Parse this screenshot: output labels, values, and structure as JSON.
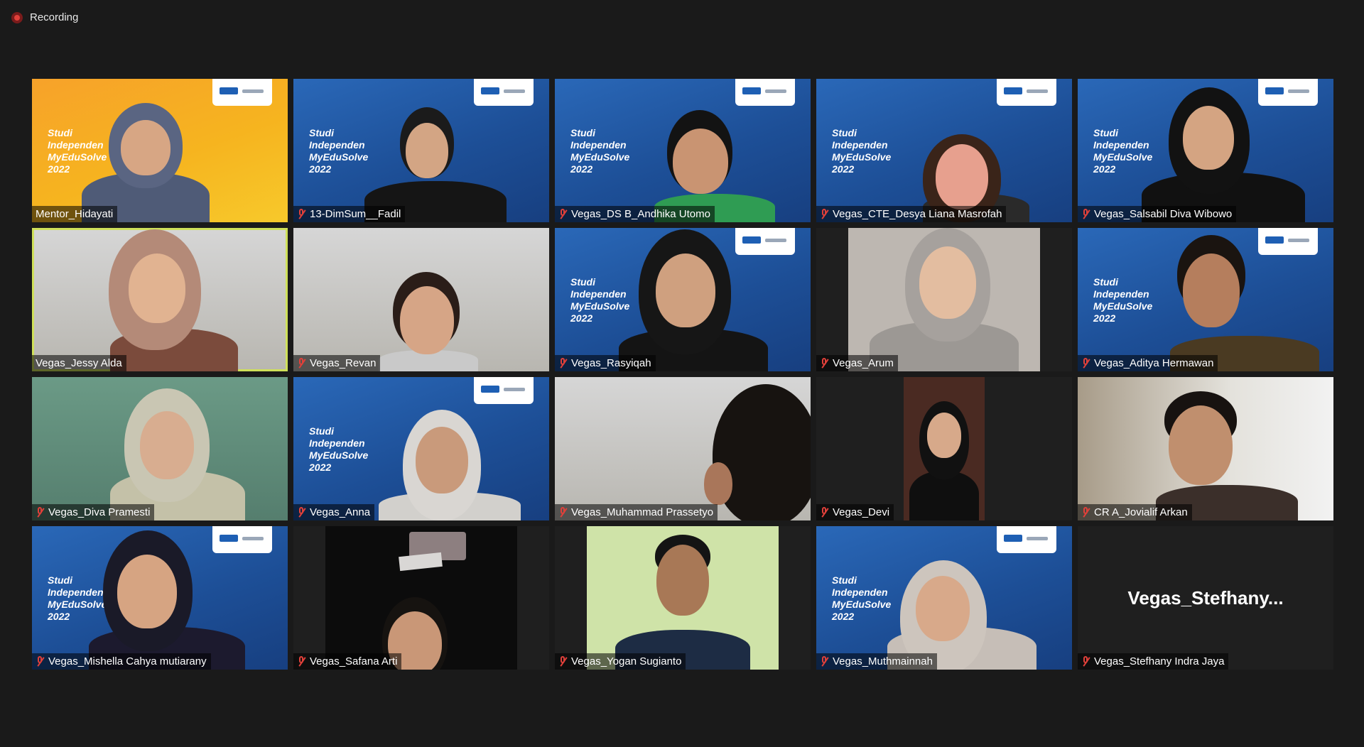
{
  "recording": {
    "label": "Recording"
  },
  "brand_text": "Studi\nIndependen\nMyEduSolve\n2022",
  "tiles": [
    {
      "name": "Mentor_Hidayati",
      "muted": false
    },
    {
      "name": "13-DimSum__Fadil",
      "muted": true
    },
    {
      "name": "Vegas_DS B_Andhika Utomo",
      "muted": true
    },
    {
      "name": "Vegas_CTE_Desya Liana Masrofah",
      "muted": true
    },
    {
      "name": "Vegas_Salsabil Diva Wibowo",
      "muted": true
    },
    {
      "name": "Vegas_Jessy Alda",
      "muted": false,
      "active": true
    },
    {
      "name": "Vegas_Revan",
      "muted": true
    },
    {
      "name": "Vegas_Rasyiqah",
      "muted": true
    },
    {
      "name": "Vegas_Arum",
      "muted": true
    },
    {
      "name": "Vegas_Aditya Hermawan",
      "muted": true
    },
    {
      "name": "Vegas_Diva Pramesti",
      "muted": true
    },
    {
      "name": "Vegas_Anna",
      "muted": true
    },
    {
      "name": "Vegas_Muhammad Prassetyo",
      "muted": true
    },
    {
      "name": "Vegas_Devi",
      "muted": true
    },
    {
      "name": "CR A_Jovialif Arkan",
      "muted": true
    },
    {
      "name": "Vegas_Mishella Cahya mutiarany",
      "muted": true
    },
    {
      "name": "Vegas_Safana Arti",
      "muted": true
    },
    {
      "name": "Vegas_Yogan Sugianto",
      "muted": true
    },
    {
      "name": "Vegas_Muthmainnah",
      "muted": true
    },
    {
      "name": "Vegas_Stefhany Indra Jaya",
      "muted": true,
      "video_off_title": "Vegas_Stefhany..."
    }
  ],
  "colors": {
    "background": "#1a1a1a",
    "active_speaker": "#cfe05a",
    "muted_icon": "#e0403a",
    "brand_blue": "#1d4f97",
    "brand_orange": "#f6b41f"
  }
}
